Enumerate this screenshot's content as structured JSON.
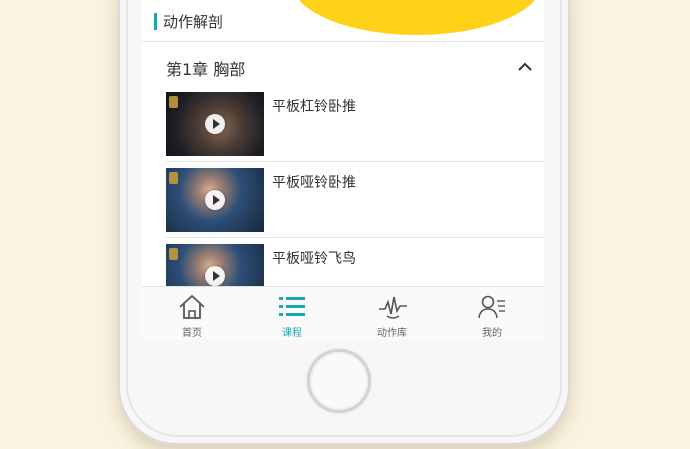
{
  "colors": {
    "accent": "#1aa7b3",
    "background": "#fbf3e0",
    "yellow": "#ffd21a"
  },
  "section": {
    "title": "动作解剖"
  },
  "chapter": {
    "title": "第1章  胸部",
    "toggle_icon": "chevron-up-icon"
  },
  "items": [
    {
      "title": "平板杠铃卧推"
    },
    {
      "title": "平板哑铃卧推"
    },
    {
      "title": "平板哑铃飞鸟"
    }
  ],
  "tabbar": {
    "tabs": [
      {
        "label": "首页",
        "icon": "home-icon",
        "active": false
      },
      {
        "label": "课程",
        "icon": "list-icon",
        "active": true
      },
      {
        "label": "动作库",
        "icon": "pulse-icon",
        "active": false
      },
      {
        "label": "我的",
        "icon": "profile-icon",
        "active": false
      }
    ]
  }
}
